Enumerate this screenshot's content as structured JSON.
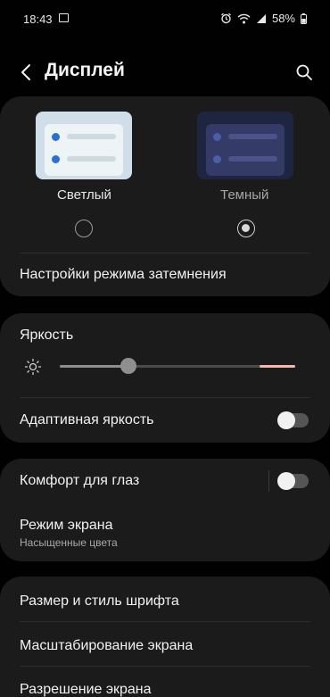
{
  "status_bar": {
    "time": "18:43",
    "battery": "58%"
  },
  "header": {
    "title": "Дисплей",
    "back_icon": "back-arrow-icon",
    "search_icon": "search-icon"
  },
  "theme": {
    "light_label": "Светлый",
    "dark_label": "Темный",
    "selected": "dark",
    "dark_mode_settings": "Настройки режима затемнения"
  },
  "brightness": {
    "label": "Яркость",
    "level": 0.29,
    "adaptive_label": "Адаптивная яркость",
    "adaptive_enabled": false
  },
  "comfort": {
    "eye_comfort_label": "Комфорт для глаз",
    "eye_comfort_enabled": false,
    "screen_mode_label": "Режим экрана",
    "screen_mode_value": "Насыщенные цвета"
  },
  "more": {
    "font_label": "Размер и стиль шрифта",
    "zoom_label": "Масштабирование экрана",
    "resolution_label": "Разрешение экрана"
  },
  "colors": {
    "background": "#010101",
    "card": "#1b1b1b",
    "accent_hint": "#f4b6b0"
  }
}
